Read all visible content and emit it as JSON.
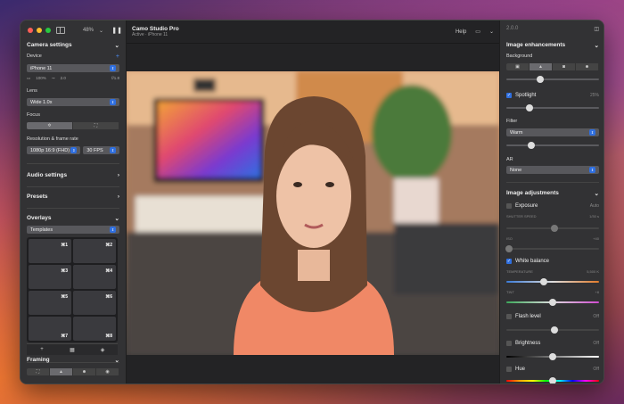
{
  "left": {
    "zoom": "48%",
    "camera_settings": "Camera settings",
    "device_label": "Device",
    "device": "iPhone 11",
    "battery": "100%",
    "temp": "2.0",
    "aperture": "f/1.8",
    "lens_label": "Lens",
    "lens": "Wide 1.0x",
    "focus_label": "Focus",
    "resolution_label": "Resolution & frame rate",
    "resolution": "1080p 16:9 (FHD)",
    "fps": "30 FPS",
    "audio": "Audio settings",
    "presets": "Presets",
    "overlays": "Overlays",
    "templates": "Templates",
    "shortcuts": [
      "⌘1",
      "⌘2",
      "⌘3",
      "⌘4",
      "⌘5",
      "⌘6",
      "⌘7",
      "⌘8"
    ],
    "framing": "Framing"
  },
  "center": {
    "title": "Camo Studio Pro",
    "subtitle": "Active · iPhone 11",
    "help": "Help"
  },
  "right": {
    "version": "2.0.0",
    "image_enhancements": "Image enhancements",
    "background": "Background",
    "background_level": 0.37,
    "spotlight": "Spotlight",
    "spotlight_value": "25%",
    "spotlight_level": 0.25,
    "filter_label": "Filter",
    "filter": "Warm",
    "filter_level": 0.27,
    "ar_label": "AR",
    "ar": "None",
    "image_adjustments": "Image adjustments",
    "exposure": "Exposure",
    "exposure_value": "Auto",
    "shutter_speed": "SHUTTER SPEED",
    "shutter_value": "1/30 s",
    "iso": "ISO",
    "iso_value": "+40",
    "white_balance": "White balance",
    "temperature": "TEMPERATURE",
    "temperature_value": "5,500 K",
    "temperature_level": 0.4,
    "tint": "TINT",
    "tint_value": "+8",
    "tint_level": 0.5,
    "flash": "Flash level",
    "flash_value": "Off",
    "brightness": "Brightness",
    "brightness_value": "Off",
    "hue": "Hue",
    "hue_value": "Off"
  }
}
